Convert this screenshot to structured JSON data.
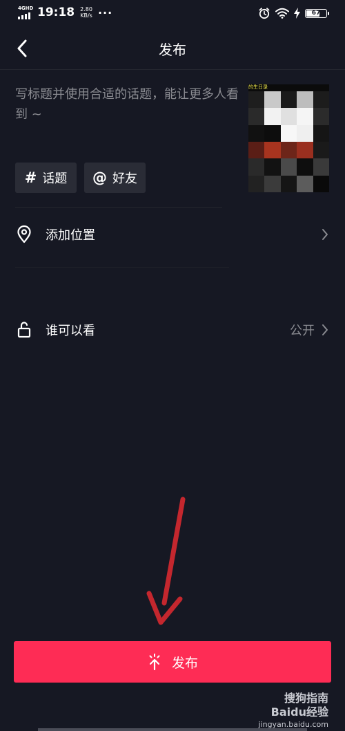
{
  "status_bar": {
    "network": "4GHD",
    "time": "19:18",
    "speed_value": "2.80",
    "speed_unit": "KB/s",
    "more": "···",
    "battery": "67",
    "icons": [
      "alarm-icon",
      "wifi-icon",
      "charging-icon",
      "battery-icon"
    ]
  },
  "nav": {
    "title": "发布",
    "back_icon": "chevron-left-icon"
  },
  "post": {
    "caption_placeholder": "写标题并使用合适的话题，能让更多人看到 ~",
    "thumbnail_label": "的生日录"
  },
  "tags": {
    "topic_symbol": "#",
    "topic_label": "话题",
    "friend_symbol": "@",
    "friend_label": "好友"
  },
  "location": {
    "label": "添加位置",
    "icon": "location-pin-icon"
  },
  "visibility": {
    "label": "谁可以看",
    "value": "公开",
    "icon": "unlock-icon"
  },
  "publish": {
    "label": "发布",
    "icon": "sparkle-up-icon",
    "color": "#fe2c55"
  },
  "watermark": {
    "brand": "Baidu经验",
    "url": "jingyan.baidu.com",
    "sogou": "搜狗指南"
  },
  "colors": {
    "background": "#161823",
    "muted_text": "#8a8b91",
    "tag_bg": "#2a2c36",
    "annotation_arrow": "#c4272e"
  }
}
